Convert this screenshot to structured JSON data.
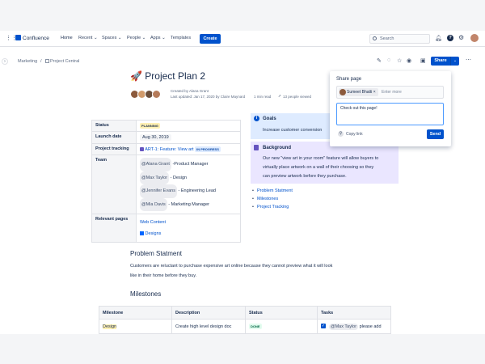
{
  "app": {
    "name": "Confluence"
  },
  "nav": {
    "home": "Home",
    "recent": "Recent",
    "spaces": "Spaces",
    "people": "People",
    "apps": "Apps",
    "templates": "Templates",
    "create": "Create",
    "search_placeholder": "Search"
  },
  "breadcrumb": {
    "space": "Marketing",
    "separator": "/",
    "page": "Project Central"
  },
  "page": {
    "title": "Project Plan 2",
    "title_emoji": "🚀",
    "created_by": "Created by Alana Grant",
    "last_updated": "Last updated: Jan 17, 2020 by Claire Maynard",
    "read_time": "1 min read",
    "views": "13 people viewed"
  },
  "properties": {
    "status_label": "Status",
    "status_value": "PLANNING",
    "launch_label": "Launch date",
    "launch_value": "Aug 30, 2019",
    "tracking_label": "Project tracking",
    "tracking_link": "ART-1: Feature: View art",
    "tracking_status": "IN PROGRESS",
    "team_label": "Team",
    "team": [
      {
        "mention": "@Alana Grant",
        "role": "-Product Manager"
      },
      {
        "mention": "@Max Taylor",
        "role": "- Design"
      },
      {
        "mention": "@Jennifer Evans",
        "role": "- Engineering Lead"
      },
      {
        "mention": "@Mia Davis",
        "role": "- Marketing Manager"
      }
    ],
    "relevant_label": "Relevant pages",
    "relevant_1": "Web Content",
    "relevant_2": "Designs"
  },
  "goals": {
    "title": "Goals",
    "text": "Increase customer conversion"
  },
  "background": {
    "title": "Background",
    "line1": "Our new \"view art in your room\" feature will allow buyers to",
    "line2": "virtually place artwork on a wall of their choosing so they",
    "line3": "can preview artwork before they purchase."
  },
  "toc": [
    "Problem Statment",
    "Milestones",
    "Project Tracking"
  ],
  "problem": {
    "heading": "Problem Statment",
    "line1": "Customers are reluctant to purchase expensive art online because they cannot preview what it will look",
    "line2": "like in their home before they buy."
  },
  "milestones": {
    "heading": "Milestones",
    "headers": [
      "Milestone",
      "Description",
      "Status",
      "Tasks"
    ],
    "row": {
      "milestone": "Design",
      "description": "Create high level design doc",
      "status": "DONE",
      "task_mention": "@Max Taylor",
      "task_text": "please add"
    }
  },
  "share": {
    "button": "Share",
    "popup_title": "Share page",
    "recipient": "Sumeet Bhatti",
    "recipient_remove": "×",
    "enter_more": "Enter more",
    "message": "Check out this page!",
    "copy_link": "Copy link",
    "send": "Send"
  },
  "colors": {
    "brand": "#0052cc",
    "goals_panel": "#deebff",
    "background_panel": "#eae6ff"
  }
}
